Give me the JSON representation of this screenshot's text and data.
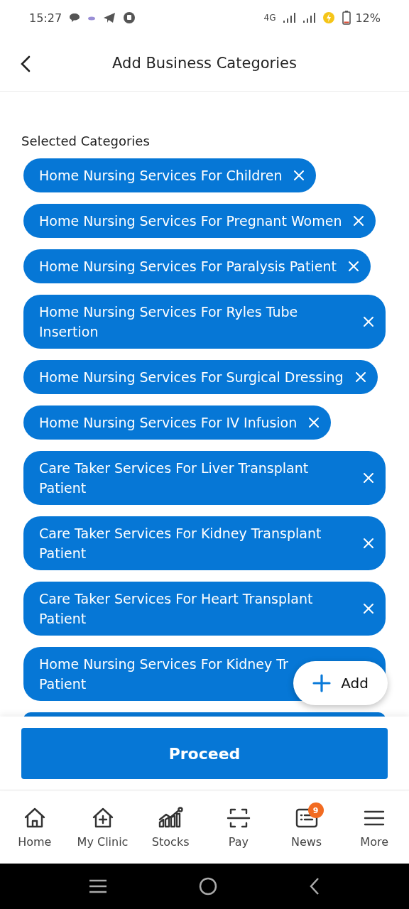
{
  "status_bar": {
    "time": "15:27",
    "network": "4G",
    "battery": "12%"
  },
  "header": {
    "title": "Add Business Categories"
  },
  "section_title": "Selected Categories",
  "categories": [
    {
      "label": "Home Nursing Services For Children",
      "removable": true
    },
    {
      "label": "Home Nursing Services For Pregnant Women",
      "removable": true
    },
    {
      "label": "Home Nursing Services For Paralysis Patient",
      "removable": true
    },
    {
      "label": "Home Nursing Services For Ryles Tube Insertion",
      "removable": true
    },
    {
      "label": "Home Nursing Services For Surgical Dressing",
      "removable": true
    },
    {
      "label": "Home Nursing Services For IV Infusion",
      "removable": true
    },
    {
      "label": "Care Taker Services For Liver Transplant Patient",
      "removable": true
    },
    {
      "label": "Care Taker Services For Kidney Transplant Patient",
      "removable": true
    },
    {
      "label": "Care Taker Services For Heart Transplant Patient",
      "removable": true
    },
    {
      "label": "Home Nursing Services For Kidney Tr\nPatient",
      "removable": false
    }
  ],
  "add_button": {
    "label": "Add"
  },
  "proceed_button": {
    "label": "Proceed"
  },
  "nav": [
    {
      "kind": "home",
      "label": "Home"
    },
    {
      "kind": "clinic",
      "label": "My Clinic"
    },
    {
      "kind": "stocks",
      "label": "Stocks"
    },
    {
      "kind": "pay",
      "label": "Pay"
    },
    {
      "kind": "news",
      "label": "News",
      "badge": "9"
    },
    {
      "kind": "more",
      "label": "More"
    }
  ]
}
